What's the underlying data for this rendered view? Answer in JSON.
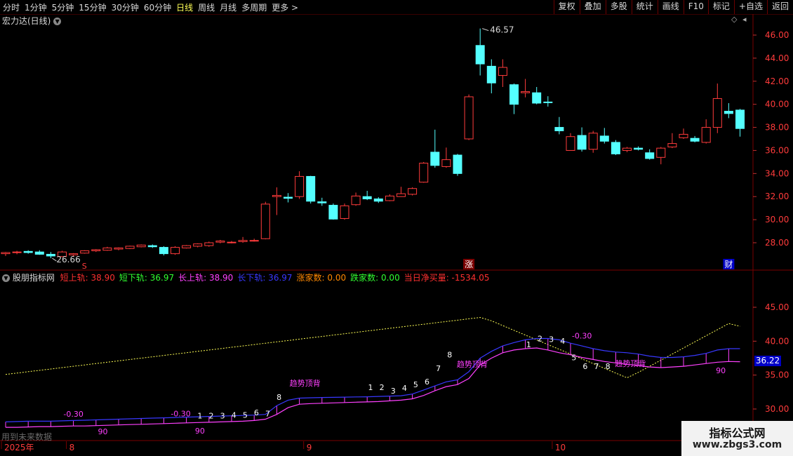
{
  "toolbar": {
    "periods": [
      "分时",
      "1分钟",
      "5分钟",
      "15分钟",
      "30分钟",
      "60分钟",
      "日线",
      "周线",
      "月线",
      "多周期",
      "更多 >"
    ],
    "active_period": "日线",
    "tools": [
      "复权",
      "叠加",
      "多股",
      "统计",
      "画线",
      "F10",
      "标记",
      "+自选",
      "返回"
    ]
  },
  "main_chart": {
    "title": "宏力达(日线)",
    "price_axis": [
      "46.00",
      "44.00",
      "42.00",
      "40.00",
      "38.00",
      "36.00",
      "34.00",
      "32.00",
      "30.00",
      "28.00"
    ],
    "high_label": "46.57",
    "low_label": "26.66",
    "markers": {
      "s": "S",
      "zhang": "涨",
      "cai": "财"
    },
    "candles": [
      {
        "o": 27.05,
        "h": 27.2,
        "l": 26.85,
        "c": 27.15
      },
      {
        "o": 27.15,
        "h": 27.3,
        "l": 27.0,
        "c": 27.2
      },
      {
        "o": 27.25,
        "h": 27.35,
        "l": 27.05,
        "c": 27.15
      },
      {
        "o": 27.2,
        "h": 27.35,
        "l": 26.95,
        "c": 27.0
      },
      {
        "o": 27.0,
        "h": 27.2,
        "l": 26.66,
        "c": 26.85
      },
      {
        "o": 26.8,
        "h": 27.3,
        "l": 26.8,
        "c": 27.2
      },
      {
        "o": 26.95,
        "h": 27.1,
        "l": 26.8,
        "c": 27.05
      },
      {
        "o": 27.1,
        "h": 27.35,
        "l": 27.05,
        "c": 27.3
      },
      {
        "o": 27.3,
        "h": 27.45,
        "l": 27.2,
        "c": 27.4
      },
      {
        "o": 27.35,
        "h": 27.65,
        "l": 27.3,
        "c": 27.55
      },
      {
        "o": 27.45,
        "h": 27.6,
        "l": 27.35,
        "c": 27.55
      },
      {
        "o": 27.5,
        "h": 27.75,
        "l": 27.45,
        "c": 27.7
      },
      {
        "o": 27.65,
        "h": 27.85,
        "l": 27.6,
        "c": 27.8
      },
      {
        "o": 27.75,
        "h": 27.85,
        "l": 27.55,
        "c": 27.65
      },
      {
        "o": 27.6,
        "h": 27.7,
        "l": 26.9,
        "c": 27.05
      },
      {
        "o": 27.05,
        "h": 27.7,
        "l": 26.95,
        "c": 27.6
      },
      {
        "o": 27.55,
        "h": 27.8,
        "l": 27.5,
        "c": 27.75
      },
      {
        "o": 27.7,
        "h": 27.95,
        "l": 27.6,
        "c": 27.9
      },
      {
        "o": 27.75,
        "h": 28.1,
        "l": 27.65,
        "c": 28.0
      },
      {
        "o": 28.05,
        "h": 28.25,
        "l": 27.95,
        "c": 28.15
      },
      {
        "o": 28.05,
        "h": 28.15,
        "l": 27.95,
        "c": 28.05
      },
      {
        "o": 28.1,
        "h": 28.5,
        "l": 28.0,
        "c": 28.2
      },
      {
        "o": 28.2,
        "h": 28.35,
        "l": 28.1,
        "c": 28.2
      },
      {
        "o": 28.35,
        "h": 31.55,
        "l": 28.3,
        "c": 31.35
      },
      {
        "o": 32.0,
        "h": 32.8,
        "l": 30.4,
        "c": 32.1
      },
      {
        "o": 31.95,
        "h": 32.3,
        "l": 31.5,
        "c": 31.85
      },
      {
        "o": 32.0,
        "h": 34.2,
        "l": 31.8,
        "c": 33.75
      },
      {
        "o": 33.75,
        "h": 33.8,
        "l": 31.4,
        "c": 31.6
      },
      {
        "o": 31.55,
        "h": 31.9,
        "l": 31.2,
        "c": 31.45
      },
      {
        "o": 31.25,
        "h": 31.4,
        "l": 30.0,
        "c": 30.05
      },
      {
        "o": 30.1,
        "h": 31.4,
        "l": 30.0,
        "c": 31.2
      },
      {
        "o": 31.3,
        "h": 32.35,
        "l": 31.2,
        "c": 32.05
      },
      {
        "o": 32.0,
        "h": 32.5,
        "l": 31.7,
        "c": 31.8
      },
      {
        "o": 31.8,
        "h": 31.95,
        "l": 31.45,
        "c": 31.6
      },
      {
        "o": 31.65,
        "h": 32.2,
        "l": 31.6,
        "c": 32.05
      },
      {
        "o": 32.0,
        "h": 32.85,
        "l": 32.0,
        "c": 32.25
      },
      {
        "o": 32.2,
        "h": 32.8,
        "l": 32.1,
        "c": 32.7
      },
      {
        "o": 33.25,
        "h": 35.0,
        "l": 33.2,
        "c": 34.9
      },
      {
        "o": 35.85,
        "h": 37.8,
        "l": 34.5,
        "c": 34.7
      },
      {
        "o": 34.6,
        "h": 36.25,
        "l": 34.5,
        "c": 35.2
      },
      {
        "o": 35.6,
        "h": 35.7,
        "l": 33.8,
        "c": 34.0
      },
      {
        "o": 37.0,
        "h": 40.85,
        "l": 36.9,
        "c": 40.65
      },
      {
        "o": 45.1,
        "h": 46.57,
        "l": 42.5,
        "c": 43.5
      },
      {
        "o": 43.3,
        "h": 43.9,
        "l": 40.95,
        "c": 41.85
      },
      {
        "o": 42.5,
        "h": 43.9,
        "l": 41.5,
        "c": 43.2
      },
      {
        "o": 41.7,
        "h": 41.8,
        "l": 39.15,
        "c": 40.0
      },
      {
        "o": 41.0,
        "h": 42.2,
        "l": 40.6,
        "c": 41.1
      },
      {
        "o": 41.0,
        "h": 41.5,
        "l": 40.0,
        "c": 40.1
      },
      {
        "o": 40.2,
        "h": 40.7,
        "l": 39.8,
        "c": 40.15
      },
      {
        "o": 38.0,
        "h": 38.9,
        "l": 37.4,
        "c": 37.7
      },
      {
        "o": 36.0,
        "h": 37.5,
        "l": 36.0,
        "c": 37.2
      },
      {
        "o": 37.3,
        "h": 38.0,
        "l": 35.9,
        "c": 36.1
      },
      {
        "o": 36.1,
        "h": 37.7,
        "l": 35.8,
        "c": 37.5
      },
      {
        "o": 37.25,
        "h": 37.95,
        "l": 36.6,
        "c": 36.8
      },
      {
        "o": 36.7,
        "h": 36.9,
        "l": 35.6,
        "c": 35.7
      },
      {
        "o": 36.0,
        "h": 36.3,
        "l": 35.85,
        "c": 36.2
      },
      {
        "o": 36.2,
        "h": 36.35,
        "l": 36.0,
        "c": 36.1
      },
      {
        "o": 35.8,
        "h": 36.1,
        "l": 35.2,
        "c": 35.3
      },
      {
        "o": 35.4,
        "h": 36.3,
        "l": 34.8,
        "c": 36.2
      },
      {
        "o": 36.3,
        "h": 37.5,
        "l": 36.2,
        "c": 36.6
      },
      {
        "o": 37.1,
        "h": 37.9,
        "l": 37.0,
        "c": 37.4
      },
      {
        "o": 37.05,
        "h": 37.25,
        "l": 36.7,
        "c": 36.8
      },
      {
        "o": 36.7,
        "h": 38.7,
        "l": 36.6,
        "c": 38.0
      },
      {
        "o": 38.0,
        "h": 41.8,
        "l": 37.5,
        "c": 40.5
      },
      {
        "o": 39.4,
        "h": 40.1,
        "l": 38.8,
        "c": 39.2
      },
      {
        "o": 39.5,
        "h": 39.6,
        "l": 37.2,
        "c": 37.9
      }
    ]
  },
  "indicator": {
    "name": "股朋指标网",
    "fields": [
      {
        "label": "短上轨: ",
        "value": "38.90",
        "color": "#ff3030"
      },
      {
        "label": "短下轨: ",
        "value": "36.97",
        "color": "#30ff30"
      },
      {
        "label": "长上轨: ",
        "value": "38.90",
        "color": "#ff40ff"
      },
      {
        "label": "长下轨: ",
        "value": "36.97",
        "color": "#3838ff"
      },
      {
        "label": "涨家数: ",
        "value": "0.00",
        "color": "#ff8800"
      },
      {
        "label": "跌家数: ",
        "value": "0.00",
        "color": "#30ff30"
      },
      {
        "label": "当日净买量: ",
        "value": "-1534.05",
        "color": "#ff3030"
      }
    ],
    "axis": [
      "45.00",
      "40.00",
      "35.00",
      "30.00"
    ],
    "current_value": "36.22",
    "annotations": [
      {
        "text": "-0.30",
        "color": "#ff40ff",
        "i": 6,
        "v": 28.85
      },
      {
        "text": "90",
        "color": "#ff40ff",
        "i": 8.6,
        "v": 26.3
      },
      {
        "text": "-0.30",
        "color": "#ff40ff",
        "i": 15.5,
        "v": 28.9
      },
      {
        "text": "90",
        "color": "#ff40ff",
        "i": 17.2,
        "v": 26.4
      },
      {
        "text": "1",
        "color": "#ffffff",
        "i": 17.2,
        "v": 28.6
      },
      {
        "text": "2",
        "color": "#ffffff",
        "i": 18.2,
        "v": 28.6
      },
      {
        "text": "3",
        "color": "#ffffff",
        "i": 19.2,
        "v": 28.6
      },
      {
        "text": "4",
        "color": "#ffffff",
        "i": 20.2,
        "v": 28.7
      },
      {
        "text": "5",
        "color": "#ffffff",
        "i": 21.2,
        "v": 28.7
      },
      {
        "text": "6",
        "color": "#ffffff",
        "i": 22.2,
        "v": 29.05
      },
      {
        "text": "7",
        "color": "#ffffff",
        "i": 23.2,
        "v": 28.9
      },
      {
        "text": "8",
        "color": "#ffffff",
        "i": 24.2,
        "v": 31.35
      },
      {
        "text": "趋势顶背",
        "color": "#ff40ff",
        "i": 26.5,
        "v": 33.4
      },
      {
        "text": "1",
        "color": "#ffffff",
        "i": 32.3,
        "v": 32.8
      },
      {
        "text": "2",
        "color": "#ffffff",
        "i": 33.3,
        "v": 32.8
      },
      {
        "text": "3",
        "color": "#ffffff",
        "i": 34.3,
        "v": 32.3
      },
      {
        "text": "4",
        "color": "#ffffff",
        "i": 35.3,
        "v": 32.7
      },
      {
        "text": "5",
        "color": "#ffffff",
        "i": 36.3,
        "v": 33.2
      },
      {
        "text": "6",
        "color": "#ffffff",
        "i": 37.3,
        "v": 33.6
      },
      {
        "text": "7",
        "color": "#ffffff",
        "i": 38.3,
        "v": 35.6
      },
      {
        "text": "8",
        "color": "#ffffff",
        "i": 39.3,
        "v": 37.6
      },
      {
        "text": "趋势顶背",
        "color": "#ff40ff",
        "i": 41.3,
        "v": 36.2
      },
      {
        "text": "1",
        "color": "#ffffff",
        "i": 46.3,
        "v": 39.1
      },
      {
        "text": "2",
        "color": "#ffffff",
        "i": 47.3,
        "v": 40.0
      },
      {
        "text": "3",
        "color": "#ffffff",
        "i": 48.3,
        "v": 39.9
      },
      {
        "text": "4",
        "color": "#ffffff",
        "i": 49.3,
        "v": 39.6
      },
      {
        "text": "-0.30",
        "color": "#ff40ff",
        "i": 51.0,
        "v": 40.4
      },
      {
        "text": "5",
        "color": "#ffffff",
        "i": 50.3,
        "v": 37.2
      },
      {
        "text": "6",
        "color": "#ffffff",
        "i": 51.3,
        "v": 35.9
      },
      {
        "text": "7",
        "color": "#ffffff",
        "i": 52.3,
        "v": 35.9
      },
      {
        "text": "8",
        "color": "#ffffff",
        "i": 53.3,
        "v": 35.9
      },
      {
        "text": "趋势顶背",
        "color": "#ff40ff",
        "i": 55.3,
        "v": 36.3
      },
      {
        "text": "90",
        "color": "#ff40ff",
        "i": 63.3,
        "v": 35.3
      }
    ],
    "upper_band": [
      28.1,
      28.15,
      28.2,
      28.2,
      28.2,
      28.25,
      28.3,
      28.35,
      28.4,
      28.45,
      28.5,
      28.55,
      28.6,
      28.65,
      28.7,
      28.75,
      28.8,
      28.85,
      28.9,
      28.95,
      29.0,
      29.05,
      29.1,
      29.2,
      30.5,
      31.3,
      31.6,
      31.65,
      31.7,
      31.72,
      31.75,
      31.78,
      31.8,
      31.85,
      31.9,
      31.95,
      32.2,
      32.8,
      33.4,
      34.0,
      34.3,
      35.5,
      37.5,
      38.5,
      39.3,
      39.8,
      40.2,
      40.4,
      40.4,
      40.2,
      39.7,
      39.3,
      38.9,
      38.6,
      38.4,
      38.3,
      38.1,
      37.8,
      37.6,
      37.6,
      37.7,
      37.9,
      38.2,
      38.7,
      38.9,
      38.9
    ],
    "lower_band": [
      27.3,
      27.3,
      27.35,
      27.4,
      27.4,
      27.45,
      27.5,
      27.5,
      27.55,
      27.6,
      27.65,
      27.7,
      27.75,
      27.8,
      27.85,
      27.9,
      27.95,
      28.0,
      28.05,
      28.1,
      28.15,
      28.2,
      28.3,
      28.5,
      29.2,
      30.2,
      30.7,
      30.8,
      30.85,
      30.9,
      30.95,
      31.0,
      31.05,
      31.1,
      31.2,
      31.3,
      31.5,
      32.0,
      32.7,
      33.3,
      33.6,
      34.5,
      36.5,
      37.5,
      38.3,
      38.7,
      38.9,
      39.0,
      38.7,
      38.3,
      38.0,
      37.6,
      37.3,
      37.0,
      36.8,
      36.6,
      36.4,
      36.2,
      36.1,
      36.2,
      36.3,
      36.5,
      36.7,
      36.9,
      37.0,
      36.97
    ],
    "dashed_line": [
      35.1,
      35.3,
      35.5,
      35.7,
      35.9,
      36.1,
      36.3,
      36.5,
      36.7,
      36.9,
      37.1,
      37.3,
      37.5,
      37.7,
      37.9,
      38.1,
      38.3,
      38.5,
      38.7,
      38.9,
      39.1,
      39.3,
      39.5,
      39.7,
      39.9,
      40.1,
      40.3,
      40.5,
      40.7,
      40.9,
      41.1,
      41.3,
      41.5,
      41.7,
      41.9,
      42.1,
      42.3,
      42.5,
      42.7,
      42.9,
      43.1,
      43.3,
      43.5,
      43.0,
      42.3,
      41.6,
      40.9,
      40.2,
      39.5,
      38.8,
      38.1,
      37.4,
      36.7,
      36.0,
      35.3,
      34.6,
      35.4,
      36.3,
      37.2,
      38.1,
      39.0,
      39.9,
      40.8,
      41.7,
      42.6,
      42.2
    ],
    "dashed_color": "#ffff55"
  },
  "date_axis": {
    "labels": [
      {
        "text": "2025年",
        "i": 0
      },
      {
        "text": "8",
        "i": 6
      },
      {
        "text": "9",
        "i": 27
      },
      {
        "text": "10",
        "i": 49
      }
    ]
  },
  "footnote": "用到未来数据",
  "watermark": {
    "title": "指标公式网",
    "url": "www.zbgs3.com"
  },
  "colors": {
    "up": "#ff3b3b",
    "down": "#54ffff",
    "grid": "#7a0000",
    "bg": "#000000"
  }
}
